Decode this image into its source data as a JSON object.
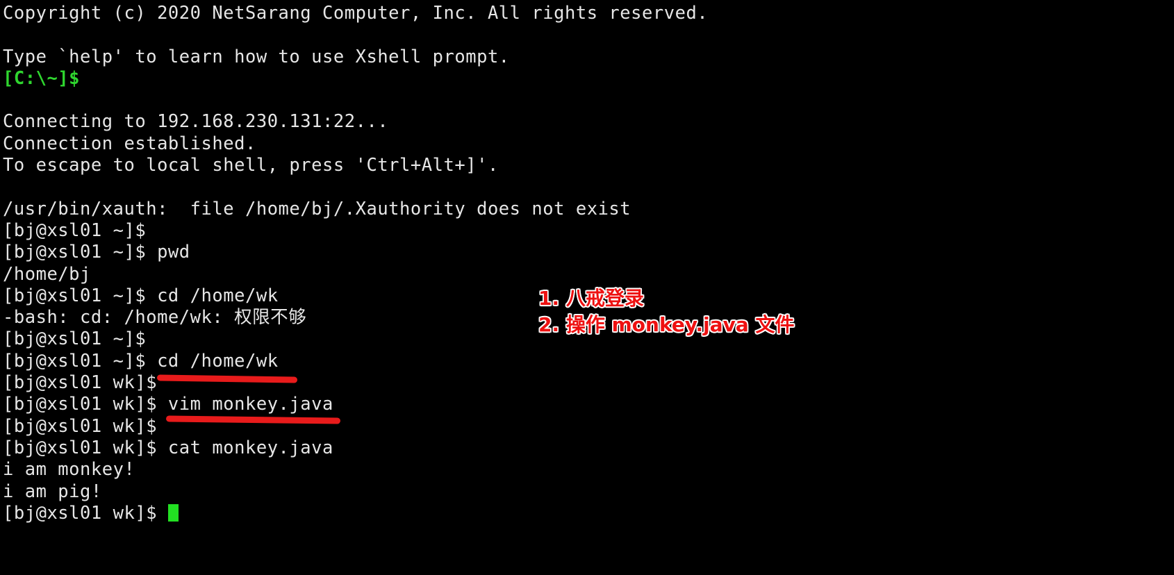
{
  "terminal": {
    "app_banner": [
      "Copyright (c) 2020 NetSarang Computer, Inc. All rights reserved.",
      "Type `help' to learn how to use Xshell prompt."
    ],
    "local_prompt": "[C:\\~]$",
    "connection": [
      "Connecting to 192.168.230.131:22...",
      "Connection established.",
      "To escape to local shell, press 'Ctrl+Alt+]'."
    ],
    "lines": {
      "l01": "Copyright (c) 2020 NetSarang Computer, Inc. All rights reserved.",
      "l02": "",
      "l03": "Type `help' to learn how to use Xshell prompt.",
      "l04": "[C:\\~]$",
      "l05": "",
      "l06": "Connecting to 192.168.230.131:22...",
      "l07": "Connection established.",
      "l08": "To escape to local shell, press 'Ctrl+Alt+]'.",
      "l09": "",
      "l10": "/usr/bin/xauth:  file /home/bj/.Xauthority does not exist",
      "l11": "[bj@xsl01 ~]$",
      "l12": "[bj@xsl01 ~]$ pwd",
      "l13": "/home/bj",
      "l14": "[bj@xsl01 ~]$ cd /home/wk",
      "l15": "-bash: cd: /home/wk: 权限不够",
      "l16": "[bj@xsl01 ~]$",
      "l17": "[bj@xsl01 ~]$ cd /home/wk",
      "l18": "[bj@xsl01 wk]$",
      "l19": "[bj@xsl01 wk]$ vim monkey.java",
      "l20": "[bj@xsl01 wk]$",
      "l21": "[bj@xsl01 wk]$ cat monkey.java",
      "l22": "i am monkey!",
      "l23": "i am pig!",
      "l24_prompt": "[bj@xsl01 wk]$ "
    },
    "host": "xsl01",
    "user": "bj",
    "remote_ip": "192.168.230.131",
    "remote_port": "22",
    "cwd_home": "/home/bj",
    "cwd_wk": "/home/wk",
    "file_name": "monkey.java",
    "file_contents": [
      "i am monkey!",
      "i am pig!"
    ],
    "error_message": "-bash: cd: /home/wk: 权限不够",
    "cursor": "block-cursor"
  },
  "annotations": {
    "line_1": "1. 八戒登录",
    "line_2": "2. 操作 monkey.java 文件",
    "underline_1_target": "cd /home/wk",
    "underline_2_target": "vim monkey.java",
    "color_red": "#e81b1b",
    "color_outline": "#ffffff"
  },
  "colors": {
    "background": "#000000",
    "foreground": "#d3d7cf",
    "prompt_green": "#2fd62f",
    "cursor_green": "#22e022"
  }
}
